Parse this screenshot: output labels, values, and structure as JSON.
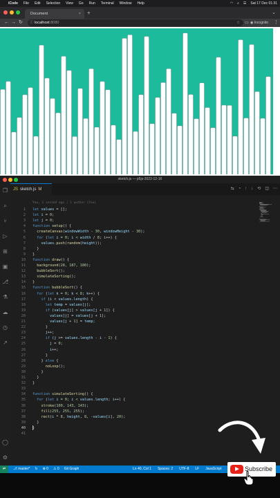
{
  "menubar": {
    "apple": "",
    "app": "iCode",
    "items": [
      "File",
      "Edit",
      "Selection",
      "View",
      "Go",
      "Run",
      "Terminal",
      "Window",
      "Help"
    ],
    "datetime": "Sat 17 Dec 01:31"
  },
  "browser": {
    "tab_title": "Document",
    "tab_close": "×",
    "new_tab": "+",
    "url_host": "localhost",
    "url_port": ":8080",
    "profile": "Incognito"
  },
  "canvas": {
    "background": "#1cbb9c",
    "bar_fill": "#ffffff",
    "bar_stroke": "#648f8f",
    "bar_width": 8
  },
  "vscode": {
    "window_title": "sketch.js — p5js-2022-12-16",
    "tab_label": "sketch.js",
    "tab_modified": "M",
    "tab_js": "JS",
    "blame": "You, 1 second ago | 1 author (You)",
    "active_line": 40,
    "lines": [
      "let values = [];",
      "let i = 0;",
      "let j = 0;",
      "function setup() {",
      "  createCanvas(windowWidth - 30, windowHeight - 30);",
      "  for (let i = 0; i < width / 8; i++) {",
      "    values.push(random(height));",
      "  }",
      "}",
      "function draw() {",
      "  background(28, 187, 180);",
      "  bubbleSort();",
      "  simulateSorting();",
      "}",
      "function bubbleSort() {",
      "  for (let k = 0; k < 8; k++) {",
      "    if (i < values.length) {",
      "      let temp = values[j];",
      "      if (values[j] > values[j + 1]) {",
      "        values[j] = values[j + 1];",
      "        values[j + 1] = temp;",
      "      }",
      "      j++;",
      "      if (j >= values.length - i - 1) {",
      "        j = 0;",
      "        i++;",
      "      }",
      "    } else {",
      "      noLoop();",
      "    }",
      "  }",
      "}",
      "",
      "function simulateSorting() {",
      "  for (let i = 0; i < values.length; i++) {",
      "    stroke(100, 143, 143);",
      "    fill(255, 255, 255);",
      "    rect(i * 8, height, 8, -values[i], 20);",
      "  }",
      "}",
      ""
    ]
  },
  "statusbar": {
    "remote": "⇄",
    "branch": "master*",
    "sync": "↻",
    "errors": "⊗ 0",
    "warnings": "⚠ 0",
    "git_graph": "Git Graph",
    "position": "Ln 40, Col 1",
    "spaces": "Spaces: 2",
    "encoding": "UTF-8",
    "eol": "LF",
    "language": "JavaScript"
  },
  "overlay": {
    "subscribe_label": "Subscribe",
    "youtube_red": "#e62117"
  },
  "colors": {
    "keyword": "#569cd6",
    "function": "#dcdcaa",
    "variable": "#9cdcfe",
    "number": "#b5cea8",
    "text": "#d4d4d4",
    "statusbar": "#007acc"
  }
}
